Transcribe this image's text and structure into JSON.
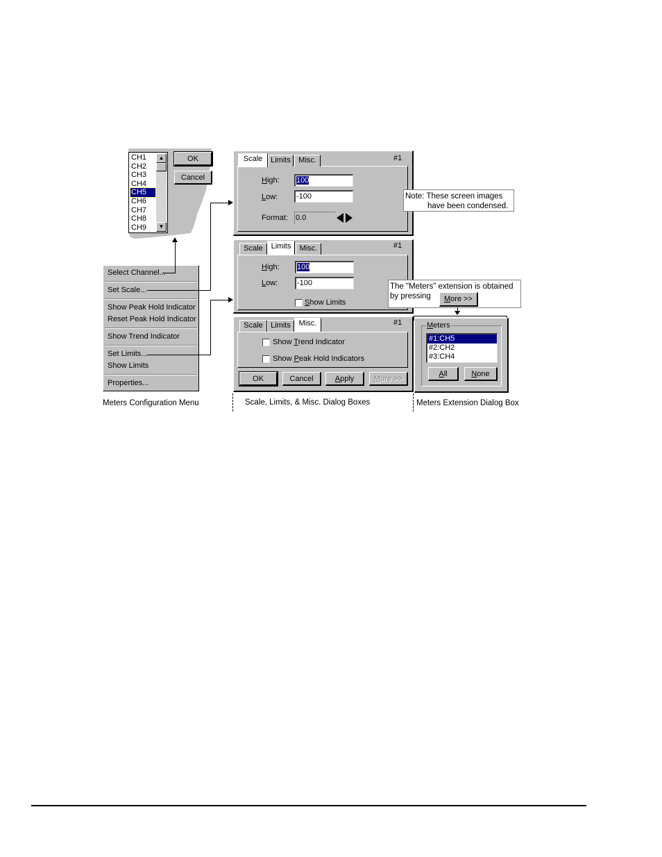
{
  "channel_dialog": {
    "channels": [
      "CH1",
      "CH2",
      "CH3",
      "CH4",
      "CH5",
      "CH6",
      "CH7",
      "CH8",
      "CH9"
    ],
    "selected": "CH5",
    "ok_label": "OK",
    "cancel_label": "Cancel"
  },
  "config_menu": {
    "items": [
      "Select Channel...",
      "Set Scale...",
      "Show Peak Hold Indicator",
      "Reset Peak Hold Indicator",
      "Show Trend Indicator",
      "Set Limits...",
      "Show Limits",
      "Properties..."
    ],
    "caption": "Meters Configuration Menu"
  },
  "tabs": {
    "scale": "Scale",
    "limits": "Limits",
    "misc": "Misc."
  },
  "meter_number": "#1",
  "scale_dialog": {
    "high_label": "High:",
    "high_value": "100",
    "low_label": "Low:",
    "low_value": "-100",
    "format_label": "Format:",
    "format_value": "0.0"
  },
  "limits_dialog": {
    "high_label": "High:",
    "high_value": "100",
    "low_label": "Low:",
    "low_value": "-100",
    "show_limits_label": "Show Limits",
    "show_limits_checked": false
  },
  "misc_dialog": {
    "show_trend_label": "Show Trend Indicator",
    "show_peak_label": "Show Peak Hold Indicators",
    "ok_label": "OK",
    "cancel_label": "Cancel",
    "apply_label": "Apply",
    "more_label": "More >>"
  },
  "dialogs_caption": "Scale, Limits, & Misc. Dialog Boxes",
  "note": {
    "line1": "Note: These screen images",
    "line2": "have been condensed."
  },
  "meters_note": {
    "line1": "The \"Meters\" extension is obtained",
    "line2": "by pressing",
    "button_label": "More >>"
  },
  "meters_extension": {
    "group_label": "Meters",
    "items": [
      "#1:CH5",
      "#2:CH2",
      "#3:CH4"
    ],
    "selected": "#1:CH5",
    "all_label": "All",
    "none_label": "None",
    "caption": "Meters Extension Dialog Box"
  }
}
